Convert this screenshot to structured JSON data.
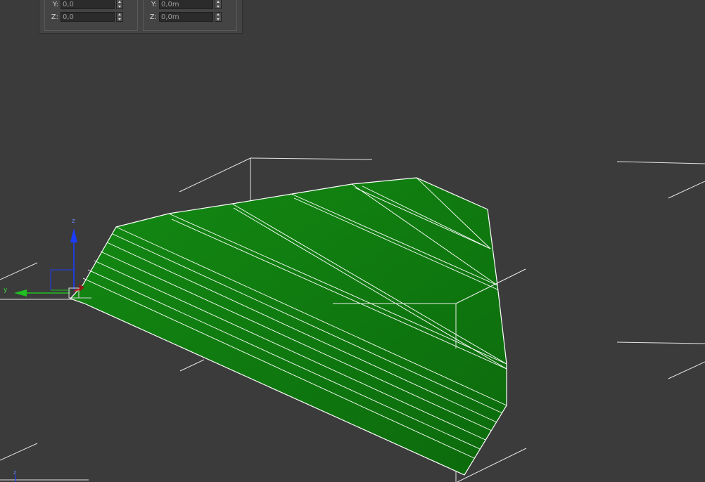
{
  "viewport": {
    "background": "#3b3b3b",
    "mesh_color": "#127d12",
    "wire_color": "#ffffff"
  },
  "transform_typein": {
    "absolute": {
      "y_label": "Y:",
      "y_value": "0,0",
      "z_label": "Z:",
      "z_value": "0,0"
    },
    "offset": {
      "y_label": "Y:",
      "y_value": "0,0m",
      "z_label": "Z:",
      "z_value": "0,0m"
    }
  },
  "gizmo": {
    "axis_z_label": "z",
    "axis_y_label": "y",
    "axis_z_color": "#1a3cff",
    "axis_y_color": "#1fc01f",
    "axis_x_color": "#d02020"
  },
  "view_axis_tripod": {
    "axis_z_label": "z"
  },
  "icons": {
    "spinner": "up-down-arrows",
    "gizmo": "move-transform-gizmo"
  }
}
